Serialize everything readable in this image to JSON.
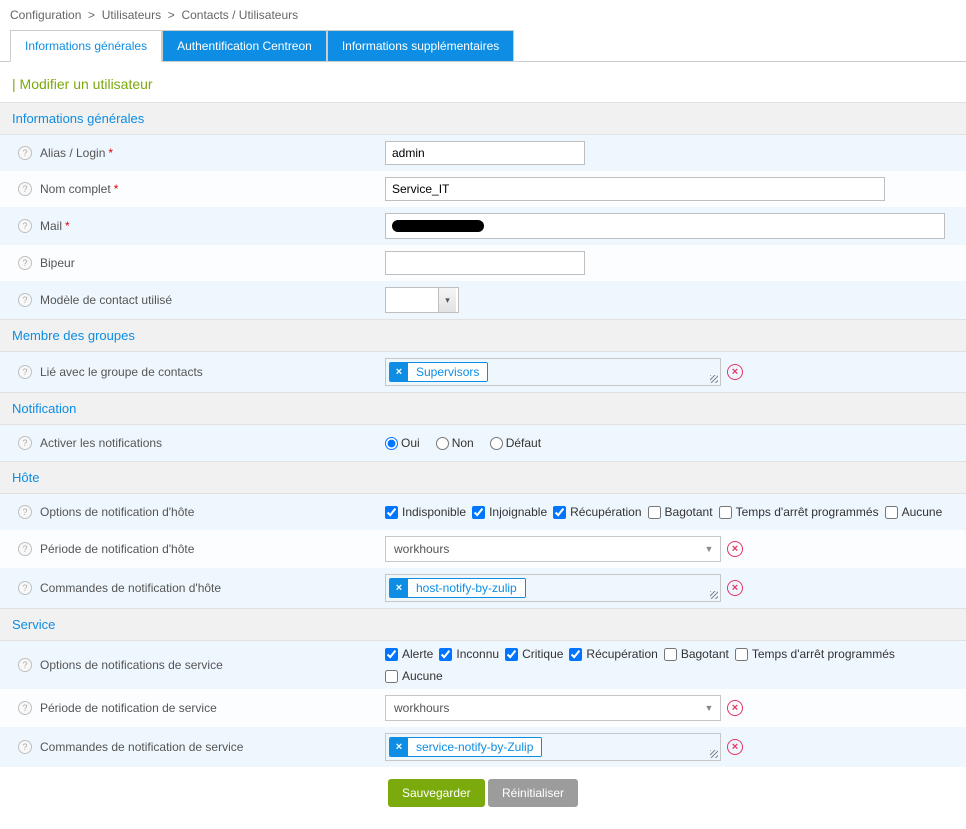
{
  "breadcrumb": [
    "Configuration",
    "Utilisateurs",
    "Contacts / Utilisateurs"
  ],
  "tabs": [
    {
      "label": "Informations générales"
    },
    {
      "label": "Authentification Centreon"
    },
    {
      "label": "Informations supplémentaires"
    }
  ],
  "page_title": "Modifier un utilisateur",
  "sections": {
    "general": {
      "header": "Informations générales",
      "alias_label": "Alias / Login",
      "alias_value": "admin",
      "fullname_label": "Nom complet",
      "fullname_value": "Service_IT",
      "mail_label": "Mail",
      "mail_value": "",
      "pager_label": "Bipeur",
      "pager_value": "",
      "template_label": "Modèle de contact utilisé",
      "template_value": ""
    },
    "groups": {
      "header": "Membre des groupes",
      "linked_label": "Lié avec le groupe de contacts",
      "linked_tag": "Supervisors"
    },
    "notification": {
      "header": "Notification",
      "enable_label": "Activer les notifications",
      "options": {
        "oui": "Oui",
        "non": "Non",
        "defaut": "Défaut"
      },
      "selected": "oui"
    },
    "host": {
      "header": "Hôte",
      "opts_label": "Options de notification d'hôte",
      "opts": [
        {
          "label": "Indisponible",
          "checked": true
        },
        {
          "label": "Injoignable",
          "checked": true
        },
        {
          "label": "Récupération",
          "checked": true
        },
        {
          "label": "Bagotant",
          "checked": false
        },
        {
          "label": "Temps d'arrêt programmés",
          "checked": false
        },
        {
          "label": "Aucune",
          "checked": false
        }
      ],
      "period_label": "Période de notification d'hôte",
      "period_value": "workhours",
      "cmd_label": "Commandes de notification d'hôte",
      "cmd_tag": "host-notify-by-zulip"
    },
    "service": {
      "header": "Service",
      "opts_label": "Options de notifications de service",
      "opts": [
        {
          "label": "Alerte",
          "checked": true
        },
        {
          "label": "Inconnu",
          "checked": true
        },
        {
          "label": "Critique",
          "checked": true
        },
        {
          "label": "Récupération",
          "checked": true
        },
        {
          "label": "Bagotant",
          "checked": false
        },
        {
          "label": "Temps d'arrêt programmés",
          "checked": false
        },
        {
          "label": "Aucune",
          "checked": false
        }
      ],
      "period_label": "Période de notification de service",
      "period_value": "workhours",
      "cmd_label": "Commandes de notification de service",
      "cmd_tag": "service-notify-by-Zulip"
    }
  },
  "actions": {
    "save": "Sauvegarder",
    "reset": "Réinitialiser"
  }
}
